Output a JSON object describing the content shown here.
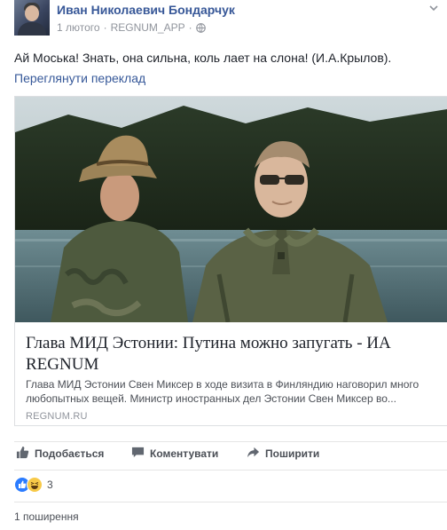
{
  "post": {
    "author": "Иван Николаевич Бондарчук",
    "date": "1 лютого",
    "separator": "·",
    "app": "REGNUM_APP",
    "app_separator": "·",
    "text": "Ай Моська! Знать, она сильна, коль лает на слона! (И.А.Крылов).",
    "translate_link": "Переглянути переклад"
  },
  "link_card": {
    "title": "Глава МИД Эстонии: Путина можно запугать - ИА REGNUM",
    "description": "Глава МИД Эстонии Свен Миксер в ходе визита в Финляндию наговорил много любопытных вещей. Министр иностранных дел Эстонии Свен Миксер во...",
    "domain": "REGNUM.RU"
  },
  "actions": {
    "like": "Подобається",
    "comment": "Коментувати",
    "share": "Поширити"
  },
  "reactions": {
    "types": [
      "like",
      "haha"
    ],
    "count": "3"
  },
  "shares": {
    "label": "1 поширення"
  },
  "colors": {
    "link_blue": "#385898",
    "meta_grey": "#90949c",
    "action_grey": "#4b4f56",
    "border": "#dddfe2"
  },
  "icons": [
    "globe-icon",
    "chevron-down-icon",
    "like-icon",
    "comment-icon",
    "share-icon",
    "like-reaction-icon",
    "haha-reaction-icon"
  ]
}
